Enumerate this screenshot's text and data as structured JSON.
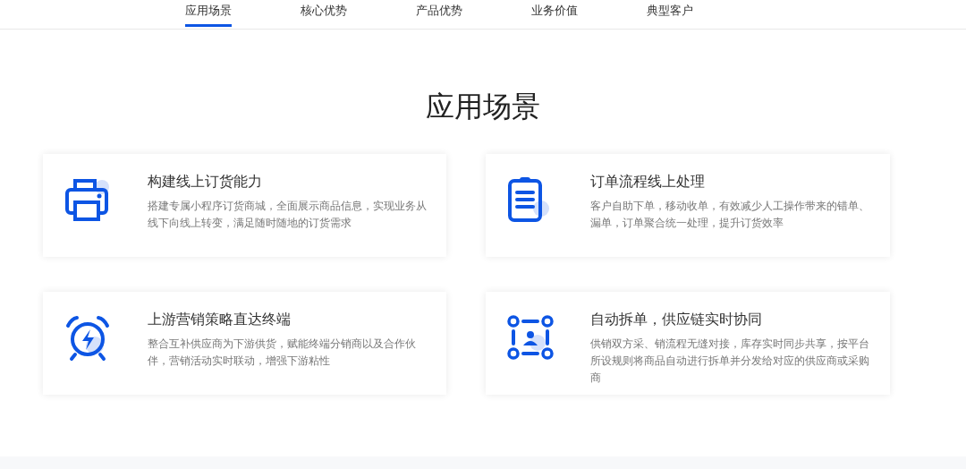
{
  "nav": {
    "tabs": [
      {
        "label": "应用场景",
        "selected": true
      },
      {
        "label": "核心优势",
        "selected": false
      },
      {
        "label": "产品优势",
        "selected": false
      },
      {
        "label": "业务价值",
        "selected": false
      },
      {
        "label": "典型客户",
        "selected": false
      }
    ]
  },
  "section": {
    "title": "应用场景",
    "cards": [
      {
        "kind": "printer",
        "title": "构建线上订货能力",
        "description": "搭建专属小程序订货商城，全面展示商品信息，实现业务从线下向线上转变，满足随时随地的订货需求"
      },
      {
        "kind": "clipboard",
        "title": "订单流程线上处理",
        "description": "客户自助下单，移动收单，有效减少人工操作带来的错单、漏单，订单聚合统一处理，提升订货效率"
      },
      {
        "kind": "alarm",
        "title": "上游营销策略直达终端",
        "description": "整合互补供应商为下游供货，赋能终端分销商以及合作伙伴，营销活动实时联动，增强下游粘性"
      },
      {
        "kind": "network",
        "title": "自动拆单，供应链实时协同",
        "description": "供销双方采、销流程无缝对接，库存实时同步共享，按平台所设规则将商品自动进行拆单并分发给对应的供应商或采购商"
      }
    ]
  }
}
